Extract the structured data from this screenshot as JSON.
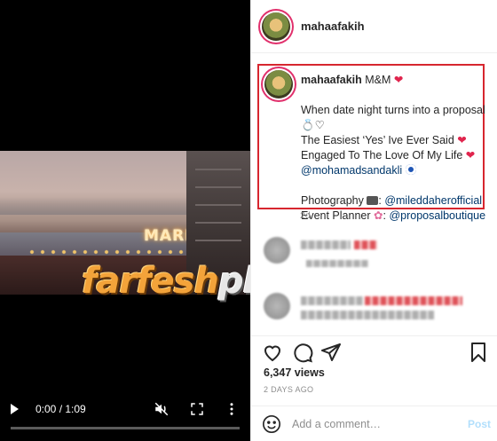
{
  "video": {
    "sign_text": "MARRY ME",
    "watermark_main": "farfesh",
    "watermark_plus": "plus.com",
    "time_display": "0:00 / 1:09",
    "progress": 0.0
  },
  "post": {
    "username": "mahaafakih",
    "caption": {
      "username": "mahaafakih",
      "title_suffix": "M&M",
      "line1": "When date night turns into a proposal",
      "line3": "The Easiest ‘Yes’ Ive Ever Said",
      "line4": "Engaged To The Love Of My Life",
      "mention1": "@mohamadsandakli",
      "photo_label": "Photography",
      "photo_mention": "@mileddaherofficial",
      "planner_label": "Event Planner",
      "planner_mention": "@proposalboutique"
    },
    "time_ago": "2d",
    "views": "6,347 views",
    "date": "2 DAYS AGO",
    "comment_placeholder": "Add a comment…",
    "post_label": "Post"
  },
  "colors": {
    "highlight_border": "#d7262f",
    "link": "#00376b",
    "post_disabled": "#b2dffc"
  },
  "icons": [
    "play-icon",
    "mute-icon",
    "fullscreen-icon",
    "more-icon",
    "heart-icon",
    "comment-icon",
    "share-icon",
    "bookmark-icon",
    "smile-icon"
  ]
}
